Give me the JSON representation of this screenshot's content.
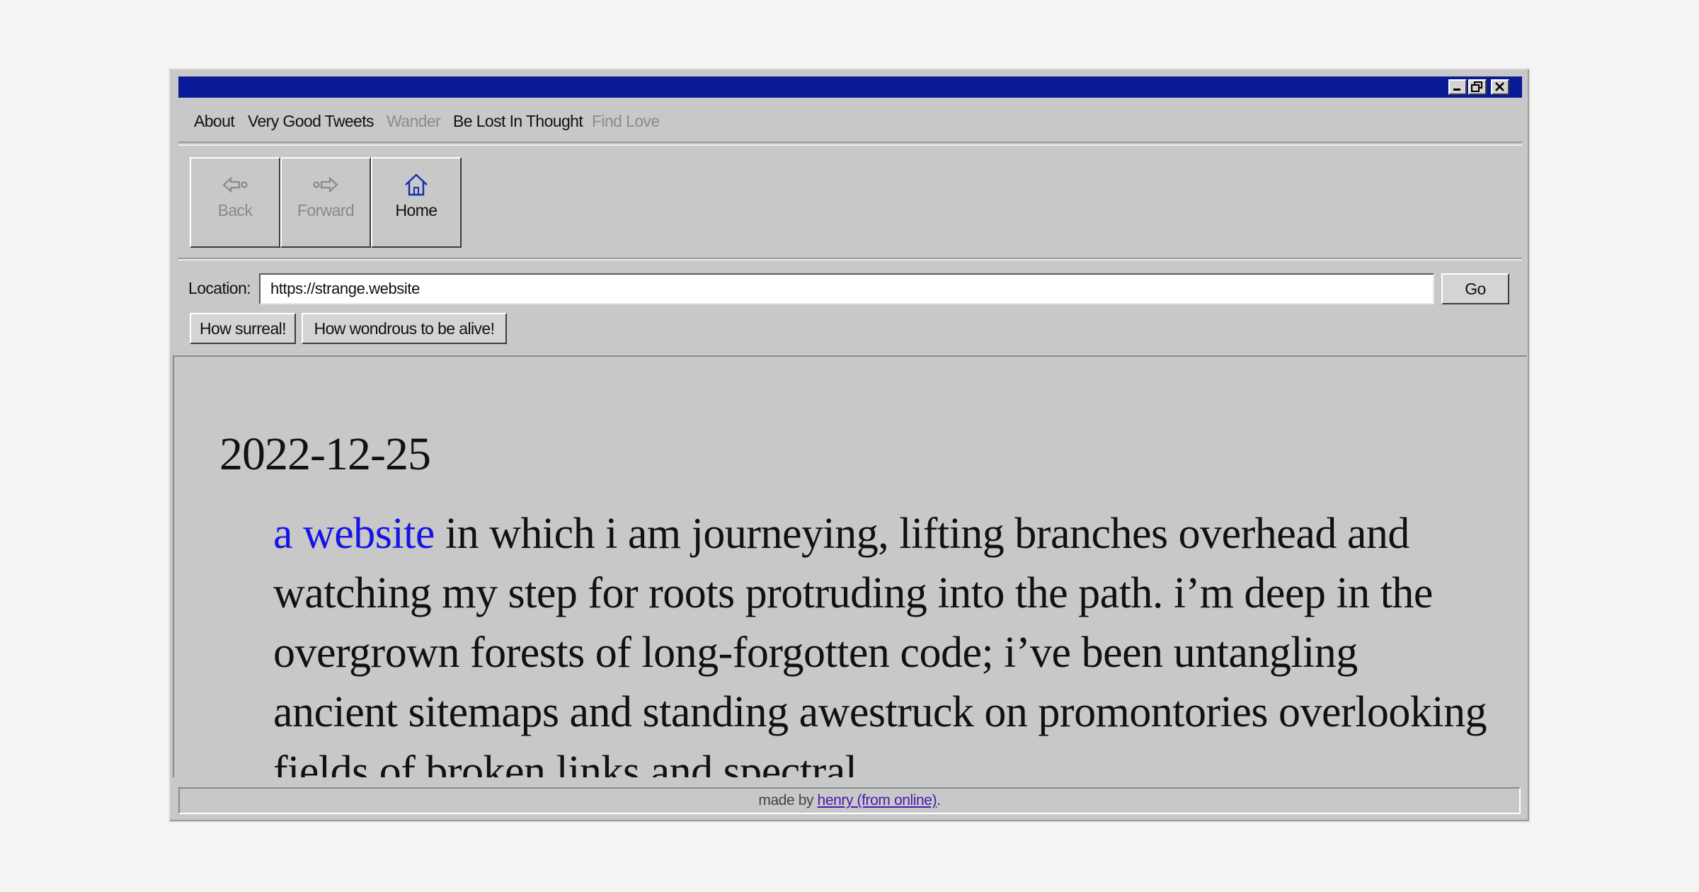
{
  "window": {
    "title_bar_color": "#0a1a96",
    "controls": {
      "minimize": "minimize-icon",
      "restore": "restore-icon",
      "close": "close-icon"
    }
  },
  "menu": {
    "items": [
      {
        "label": "About",
        "enabled": true
      },
      {
        "label": "Very Good Tweets",
        "enabled": true
      },
      {
        "label": "Wander",
        "enabled": false
      },
      {
        "label": "Be Lost In Thought",
        "enabled": true
      },
      {
        "label": "Find Love",
        "enabled": false
      }
    ]
  },
  "toolbar": {
    "back_label": "Back",
    "forward_label": "Forward",
    "home_label": "Home"
  },
  "location": {
    "label": "Location:",
    "value": "https://strange.website",
    "go_label": "Go"
  },
  "quick_buttons": {
    "surreal": "How surreal!",
    "alive": "How wondrous to be alive!"
  },
  "content": {
    "date": "2022-12-25",
    "link_text": "a website",
    "body": " in which i am journeying, lifting branches overhead and watching my step for roots protruding into the path. i’m deep in the overgrown forests of long-forgotten code; i’ve been untangling ancient sitemaps and standing awestruck on promontories overlooking fields of broken links and spectral"
  },
  "status": {
    "prefix": "made by ",
    "link": "henry (from online)",
    "suffix": "."
  },
  "colors": {
    "link": "#1414e6",
    "status_link": "#4a1ab0",
    "chrome": "#c8c8c8"
  }
}
